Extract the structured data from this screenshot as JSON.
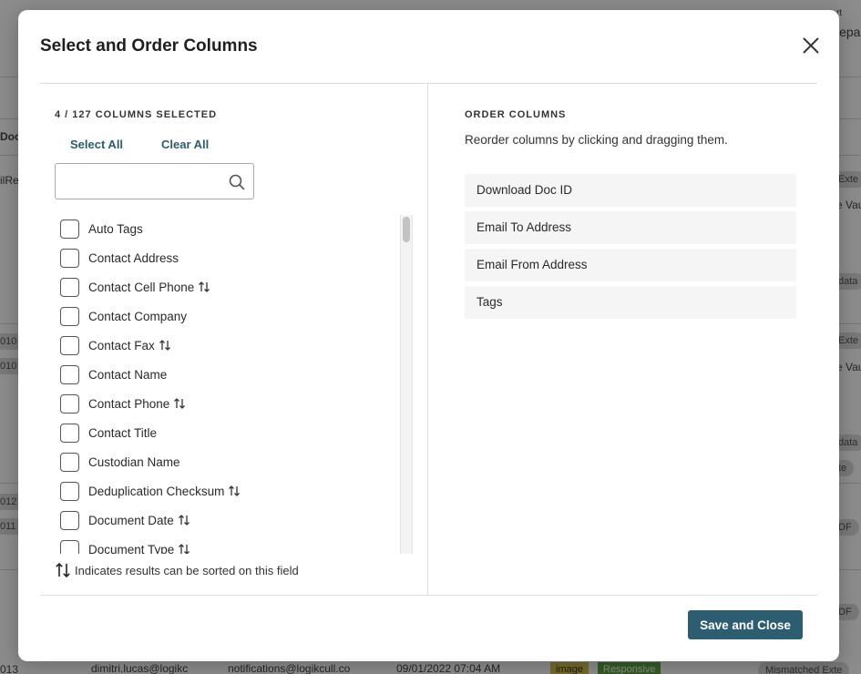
{
  "modal": {
    "title": "Select and Order Columns",
    "close_icon": "close-icon"
  },
  "left_panel": {
    "count_label": "4 / 127 COLUMNS SELECTED",
    "select_all": "Select All",
    "clear_all": "Clear All",
    "search": {
      "value": "",
      "placeholder": "",
      "icon": "search-icon"
    },
    "columns": [
      {
        "label": "Auto Tags",
        "checked": false,
        "sortable": false
      },
      {
        "label": "Contact Address",
        "checked": false,
        "sortable": false
      },
      {
        "label": "Contact Cell Phone",
        "checked": false,
        "sortable": true
      },
      {
        "label": "Contact Company",
        "checked": false,
        "sortable": false
      },
      {
        "label": "Contact Fax",
        "checked": false,
        "sortable": true
      },
      {
        "label": "Contact Name",
        "checked": false,
        "sortable": false
      },
      {
        "label": "Contact Phone",
        "checked": false,
        "sortable": true
      },
      {
        "label": "Contact Title",
        "checked": false,
        "sortable": false
      },
      {
        "label": "Custodian Name",
        "checked": false,
        "sortable": false
      },
      {
        "label": "Deduplication Checksum",
        "checked": false,
        "sortable": true
      },
      {
        "label": "Document Date",
        "checked": false,
        "sortable": true
      },
      {
        "label": "Document Type",
        "checked": false,
        "sortable": true
      }
    ],
    "legend": "Indicates results can be sorted on this field"
  },
  "right_panel": {
    "title": "ORDER COLUMNS",
    "description": "Reorder columns by clicking and dragging them.",
    "ordered_columns": [
      "Download Doc ID",
      "Email To Address",
      "Email From Address",
      "Tags"
    ]
  },
  "footer": {
    "save_label": "Save and Close"
  },
  "background": {
    "fragments": [
      "Doc",
      "ilRef",
      "010",
      "010",
      "012",
      "011",
      "013",
      "rt",
      "lepa",
      "Exte",
      "e Vau",
      "data",
      "Exte",
      "e Vau",
      "data",
      "te",
      "DF",
      "DF"
    ],
    "row_cells": [
      "dimitri.lucas@logikc",
      "notifications@logikcull.co",
      "09/01/2022 07:04 AM"
    ],
    "tag_image": "image",
    "tag_responsive": "Responsive",
    "tag_mismatch": "Mismatched Exte"
  },
  "colors": {
    "accent": "#2d5d70",
    "link": "#2c5c6e",
    "order_item_bg": "#f4f5f4",
    "overlay": "rgba(0,0,0,0.45)"
  }
}
